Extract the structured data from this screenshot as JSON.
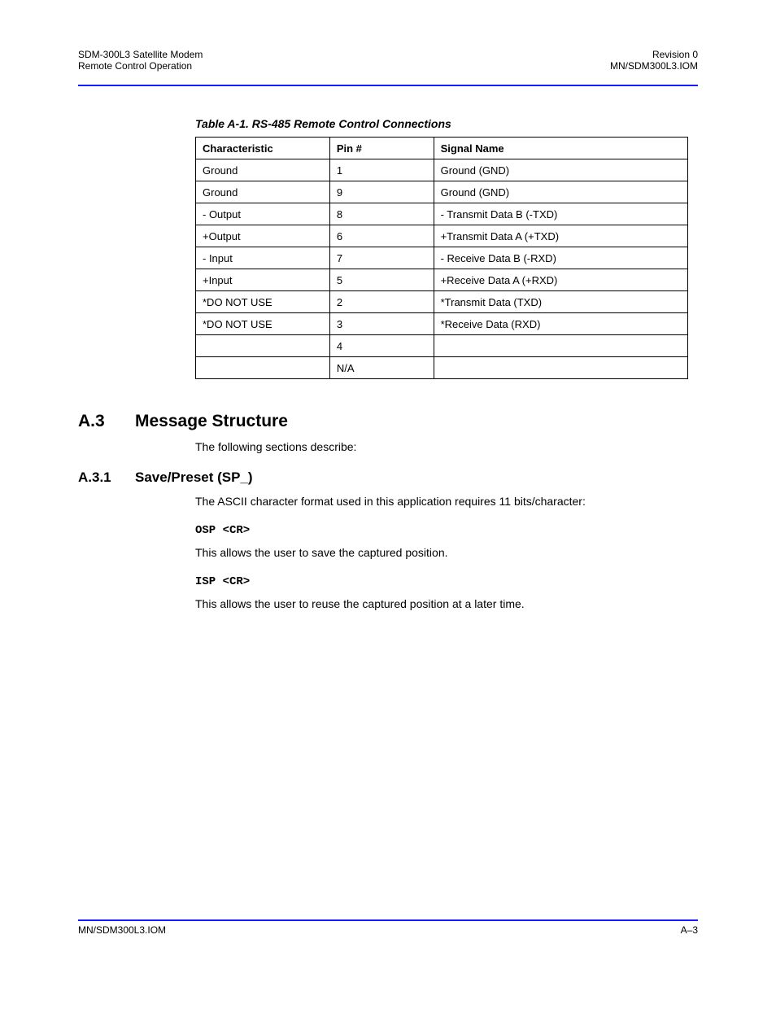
{
  "header": {
    "bookTitle": "SDM-300L3 Satellite Modem",
    "chapter": "Remote Control Operation",
    "revision": "Revision 0",
    "docnum": "MN/SDM300L3.IOM"
  },
  "tableCaption": "Table A-1. RS-485 Remote Control Connections",
  "table": {
    "headers": [
      "Characteristic",
      "Pin #",
      "Signal Name"
    ],
    "rows": [
      [
        "Ground",
        "1",
        "Ground (GND)"
      ],
      [
        "Ground",
        "9",
        "Ground (GND)"
      ],
      [
        "- Output",
        "8",
        "- Transmit Data B (-TXD)"
      ],
      [
        "+Output",
        "6",
        "+Transmit Data A (+TXD)"
      ],
      [
        "- Input",
        "7",
        "- Receive Data B (-RXD)"
      ],
      [
        "+Input",
        "5",
        "+Receive Data A (+RXD)"
      ],
      [
        "*DO NOT USE",
        "2",
        "*Transmit Data (TXD)"
      ],
      [
        "*DO NOT USE",
        "3",
        "*Receive Data (RXD)"
      ],
      [
        "",
        "4",
        ""
      ],
      [
        "",
        "N/A",
        ""
      ]
    ]
  },
  "section": {
    "num": "A.3",
    "title": "Message Structure"
  },
  "subsection": {
    "num": "A.3.1",
    "title": "Save/Preset (SP_)"
  },
  "body": {
    "intro": "The following sections describe:",
    "p1": "The ASCII character format used in this application requires 11 bits/character:",
    "cmd1": "OSP <CR>",
    "note1": "This allows the user to save the captured position.",
    "cmd2": "ISP <CR>",
    "note2": "This allows the user to reuse the captured position at a later time."
  },
  "footer": {
    "left": "MN/SDM300L3.IOM",
    "right": "A–3"
  }
}
